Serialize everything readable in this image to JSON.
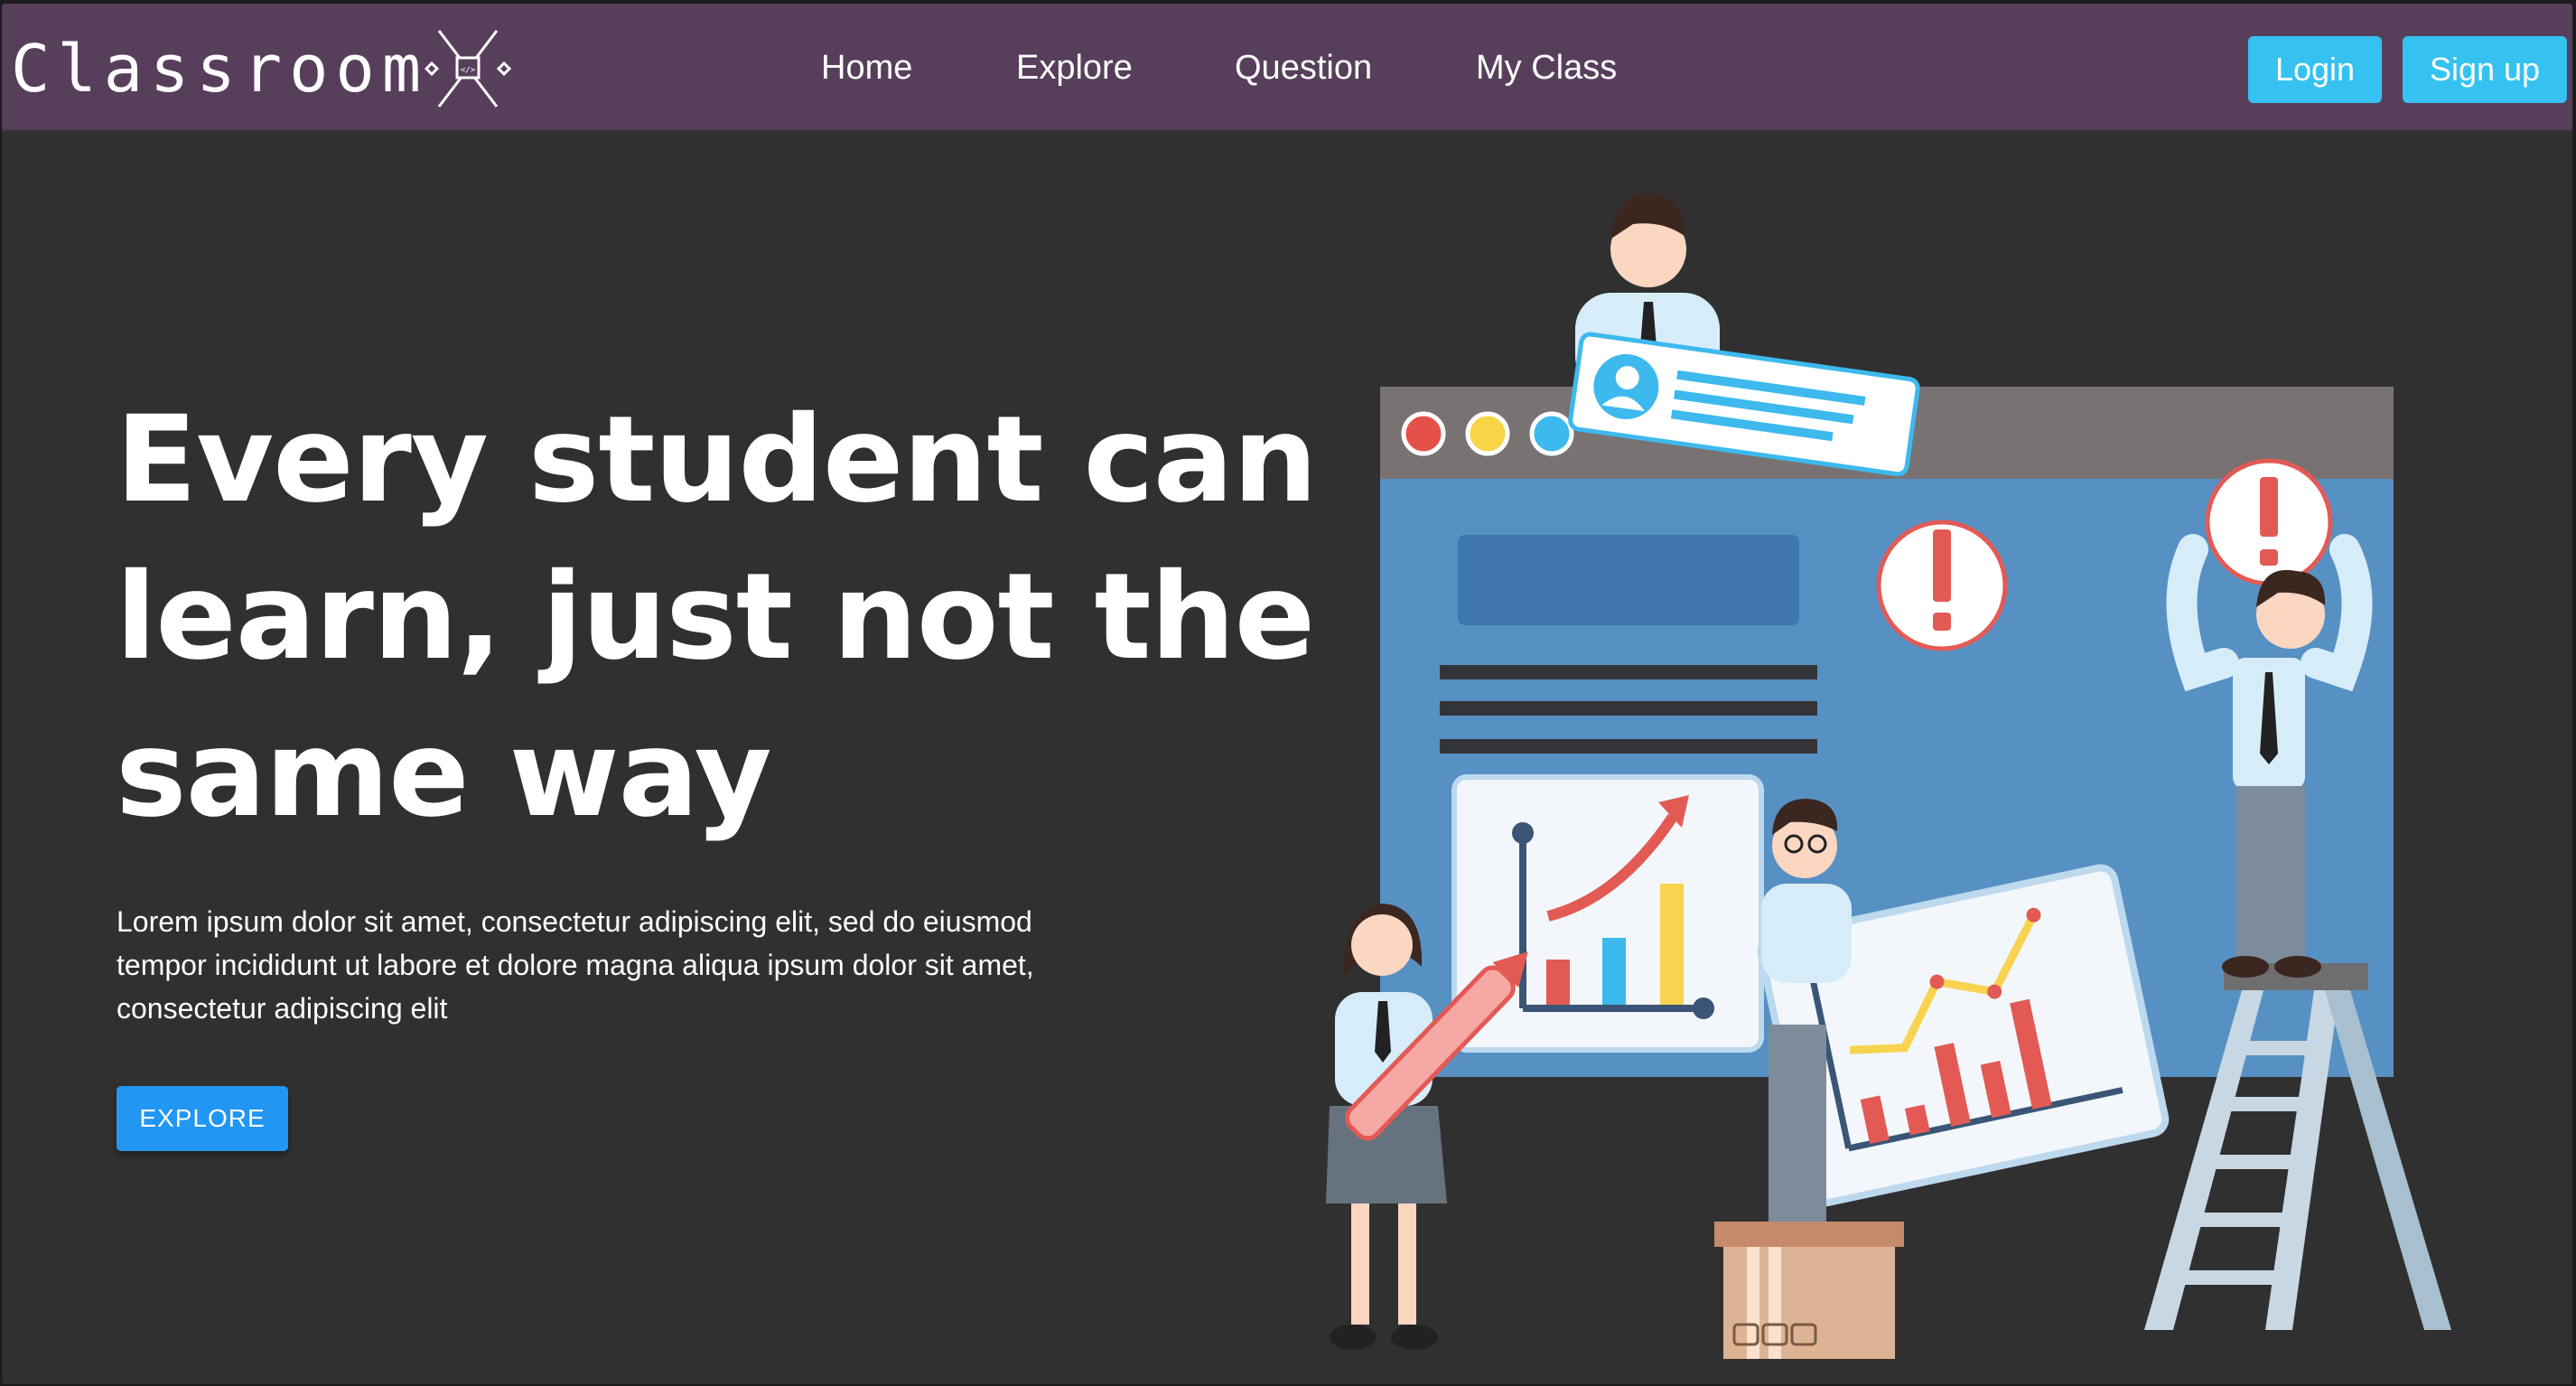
{
  "brand": {
    "name": "Classroom",
    "logo_icon": "code-tag-x-icon"
  },
  "nav": {
    "links": [
      {
        "label": "Home"
      },
      {
        "label": "Explore"
      },
      {
        "label": "Question"
      },
      {
        "label": "My Class"
      }
    ],
    "login_label": "Login",
    "signup_label": "Sign up"
  },
  "hero": {
    "title_lines": [
      "Every student can",
      "learn, just not the",
      "same way"
    ],
    "description_lines": [
      "Lorem ipsum dolor sit amet, consectetur adipiscing elit, sed do eiusmod",
      "tempor incididunt ut labore et dolore magna aliqua ipsum dolor sit amet,",
      "consectetur adipiscing elit"
    ],
    "cta_label": "EXPLORE"
  },
  "illustration": {
    "subject": "team-with-charts-illustration",
    "window_dots": [
      "#e5504b",
      "#f8d547",
      "#3db9ee"
    ],
    "colors": {
      "panel": "#5791c3",
      "window_bar": "#787272",
      "accent_red": "#e35a55",
      "accent_yellow": "#f7d34f",
      "accent_blue": "#3db9ee"
    }
  },
  "theme": {
    "navbar": "#573f5c",
    "background": "#303030",
    "button_top": "#36c2f0",
    "button_cta": "#2196f3"
  }
}
